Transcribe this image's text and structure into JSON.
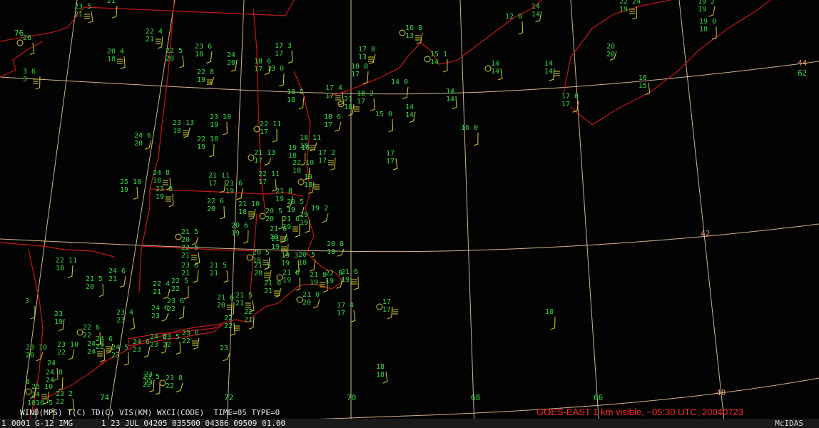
{
  "legend": "WIND(MPS) T(C) TD(C) VIS(KM) WXCI(CODE)  TIME=05 TYPE=0",
  "caption": "GOES-EAST 1 km visible, ~05:30 UTC, 20040723",
  "status": {
    "frame": "1",
    "line": "0001 G-12 IMG      1 23 JUL 04205 035500 04386 09509 01.00",
    "brand": "McIDAS"
  },
  "grid_labels": {
    "lon": [
      "74",
      "72",
      "70",
      "68",
      "66"
    ],
    "lat": [
      "44",
      "42",
      "40"
    ],
    "edge": [
      "76",
      "62"
    ]
  },
  "stations": [
    {
      "t": "23 5",
      "b": "21"
    },
    {
      "t": "21",
      "b": ""
    },
    {
      "t": "26",
      "b": ""
    },
    {
      "t": "22 4",
      "b": "21"
    },
    {
      "t": "22 5",
      "b": "20"
    },
    {
      "t": "23 6",
      "b": "18"
    },
    {
      "t": "20 4",
      "b": "18"
    },
    {
      "t": "24",
      "b": "20"
    },
    {
      "t": "17 3",
      "b": "17"
    },
    {
      "t": "16 8",
      "b": "13"
    },
    {
      "t": "12 0",
      "b": ""
    },
    {
      "t": "14",
      "b": "14"
    },
    {
      "t": "22 24",
      "b": "19"
    },
    {
      "t": "19 2",
      "b": "19"
    },
    {
      "t": "19 0",
      "b": "18"
    },
    {
      "t": "17 8",
      "b": "13"
    },
    {
      "t": "15 1",
      "b": "14"
    },
    {
      "t": "20",
      "b": "20"
    },
    {
      "t": "3 6",
      "b": "3"
    },
    {
      "t": "18 6",
      "b": "17"
    },
    {
      "t": "13 0",
      "b": ""
    },
    {
      "t": "22 8",
      "b": "19"
    },
    {
      "t": "18 8",
      "b": "17"
    },
    {
      "t": "14",
      "b": "14"
    },
    {
      "t": "14",
      "b": "14"
    },
    {
      "t": "16",
      "b": "15"
    },
    {
      "t": "18 5",
      "b": "18"
    },
    {
      "t": "17 4",
      "b": "17"
    },
    {
      "t": "14 0",
      "b": ""
    },
    {
      "t": "18 2",
      "b": "17"
    },
    {
      "t": "21",
      "b": "18"
    },
    {
      "t": "14",
      "b": "14"
    },
    {
      "t": "17 0",
      "b": "17"
    },
    {
      "t": "15 0",
      "b": ""
    },
    {
      "t": "14",
      "b": "14"
    },
    {
      "t": "23 10",
      "b": "19"
    },
    {
      "t": "23 13",
      "b": "18"
    },
    {
      "t": "22 11",
      "b": "17"
    },
    {
      "t": "18 6",
      "b": "17"
    },
    {
      "t": "16 0",
      "b": ""
    },
    {
      "t": "24 6",
      "b": "20"
    },
    {
      "t": "22 10",
      "b": "19"
    },
    {
      "t": "18 11",
      "b": "18"
    },
    {
      "t": "19 16",
      "b": "18"
    },
    {
      "t": "21 13",
      "b": "17"
    },
    {
      "t": "17 2",
      "b": "17"
    },
    {
      "t": "17",
      "b": "17"
    },
    {
      "t": "22 10",
      "b": "18"
    },
    {
      "t": "24 8",
      "b": "18"
    },
    {
      "t": "21 11",
      "b": "17"
    },
    {
      "t": "22 11",
      "b": "17"
    },
    {
      "t": "19",
      "b": "18"
    },
    {
      "t": "25 10",
      "b": "19"
    },
    {
      "t": "21 6",
      "b": "19"
    },
    {
      "t": "23 8",
      "b": "19"
    },
    {
      "t": "21 8",
      "b": "19"
    },
    {
      "t": "22 6",
      "b": "20"
    },
    {
      "t": "21 10",
      "b": "18"
    },
    {
      "t": "20 5",
      "b": "20"
    },
    {
      "t": "20 5",
      "b": "19"
    },
    {
      "t": "21 6",
      "b": "19"
    },
    {
      "t": "19 2",
      "b": ""
    },
    {
      "t": "19",
      "b": "19"
    },
    {
      "t": "21 6",
      "b": "19"
    },
    {
      "t": "20 6",
      "b": "19"
    },
    {
      "t": "21 5",
      "b": "20"
    },
    {
      "t": "21 6",
      "b": "19"
    },
    {
      "t": "20 8",
      "b": "19"
    },
    {
      "t": "22 11",
      "b": "18"
    },
    {
      "t": "22 5",
      "b": "21"
    },
    {
      "t": "23 6",
      "b": "21"
    },
    {
      "t": "21 5",
      "b": "21"
    },
    {
      "t": "20 5",
      "b": "18"
    },
    {
      "t": "19 3",
      "b": "19"
    },
    {
      "t": "20 5",
      "b": "18"
    },
    {
      "t": "21 8",
      "b": "19"
    },
    {
      "t": "24 6",
      "b": "21"
    },
    {
      "t": "21 5",
      "b": "20"
    },
    {
      "t": "21 5",
      "b": "20"
    },
    {
      "t": "21 8",
      "b": "19"
    },
    {
      "t": "22 8",
      "b": "19"
    },
    {
      "t": "21 6",
      "b": "19"
    },
    {
      "t": "22 4",
      "b": "21"
    },
    {
      "t": "22 5",
      "b": "22"
    },
    {
      "t": "21 0",
      "b": "21"
    },
    {
      "t": "3",
      "b": ""
    },
    {
      "t": "21 0",
      "b": "20"
    },
    {
      "t": "21 6",
      "b": "20"
    },
    {
      "t": "24 6",
      "b": "23"
    },
    {
      "t": "23 6",
      "b": "22"
    },
    {
      "t": "21 5",
      "b": "21"
    },
    {
      "t": "22",
      "b": "21"
    },
    {
      "t": "17 4",
      "b": "17"
    },
    {
      "t": "17",
      "b": "17"
    },
    {
      "t": "23 4",
      "b": "23"
    },
    {
      "t": "23",
      "b": "19"
    },
    {
      "t": "22",
      "b": "22"
    },
    {
      "t": "24 6",
      "b": "23"
    },
    {
      "t": "23 5",
      "b": "22"
    },
    {
      "t": "23 6",
      "b": "22"
    },
    {
      "t": "22 6",
      "b": "22"
    },
    {
      "t": "24 6",
      "b": "23"
    },
    {
      "t": "24 8",
      "b": "24"
    },
    {
      "t": "23 10",
      "b": "22"
    },
    {
      "t": "24 5",
      "b": "23"
    },
    {
      "t": "24 6",
      "b": "22"
    },
    {
      "t": "23 5",
      "b": "22"
    },
    {
      "t": "23 8",
      "b": "22"
    },
    {
      "t": "18",
      "b": ""
    },
    {
      "t": "23 10",
      "b": "20"
    },
    {
      "t": "24 8",
      "b": "24"
    },
    {
      "t": "23",
      "b": ""
    },
    {
      "t": "23",
      "b": "23"
    },
    {
      "t": "18",
      "b": "18"
    },
    {
      "t": "25 10",
      "b": "24"
    },
    {
      "t": "23 2",
      "b": "22"
    },
    {
      "t": "10",
      "b": ""
    },
    {
      "t": "10 5",
      "b": ""
    },
    {
      "t": "8",
      "b": ""
    },
    {
      "t": "24",
      "b": ""
    }
  ]
}
